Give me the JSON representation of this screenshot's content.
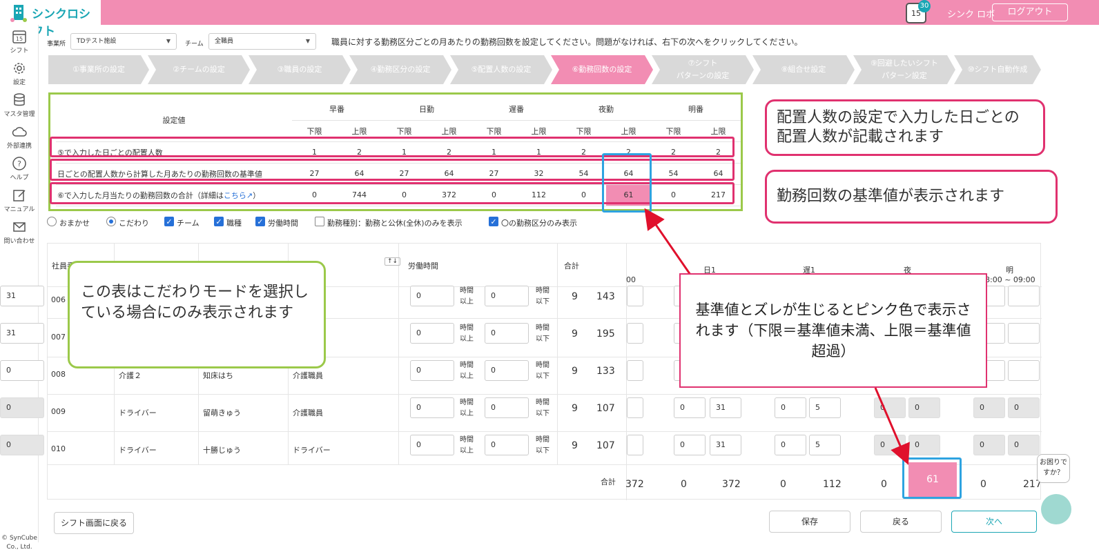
{
  "app": {
    "name": "シンクロシフト",
    "calendar_badge": "30",
    "calendar_day": "15",
    "user": "シンク ロボ",
    "logout": "ログアウト"
  },
  "sidebar": [
    {
      "label": "シフト",
      "icon": "calendar-icon"
    },
    {
      "label": "設定",
      "icon": "gear-icon"
    },
    {
      "label": "マスタ管理",
      "icon": "database-icon"
    },
    {
      "label": "外部連携",
      "icon": "cloud-icon"
    },
    {
      "label": "ヘルプ",
      "icon": "help-icon"
    },
    {
      "label": "マニュアル",
      "icon": "manual-icon"
    },
    {
      "label": "問い合わせ",
      "icon": "mail-icon"
    }
  ],
  "copyright": "© SynCube Co., Ltd.",
  "filters": {
    "office_label": "事業所",
    "office_value": "TDテスト施設",
    "team_label": "チーム",
    "team_value": "全職員"
  },
  "instruction": "職員に対する勤務区分ごとの月あたりの勤務回数を設定してください。問題がなければ、右下の次へをクリックしてください。",
  "steps": [
    {
      "label": "①事業所の設定"
    },
    {
      "label": "②チームの設定"
    },
    {
      "label": "③職員の設定"
    },
    {
      "label": "④勤務区分の設定"
    },
    {
      "label": "⑤配置人数の設定"
    },
    {
      "label": "⑥勤務回数の設定",
      "active": true
    },
    {
      "label": "⑦シフト",
      "label2": "パターンの設定"
    },
    {
      "label": "⑧組合せ設定"
    },
    {
      "label": "⑨回避したいシフト",
      "label2": "パターン設定"
    },
    {
      "label": "⑩シフト自動作成"
    }
  ],
  "summary": {
    "header_label": "設定値",
    "groups": [
      "早番",
      "日勤",
      "遅番",
      "夜勤",
      "明番"
    ],
    "sub": [
      "下限",
      "上限"
    ],
    "rows": [
      {
        "label": "⑤で入力した日ごとの配置人数",
        "values": [
          "1",
          "2",
          "1",
          "2",
          "1",
          "1",
          "2",
          "2",
          "2",
          "2"
        ]
      },
      {
        "label": "日ごとの配置人数から計算した月あたりの勤務回数の基準値",
        "values": [
          "27",
          "64",
          "27",
          "64",
          "27",
          "32",
          "54",
          "64",
          "54",
          "64"
        ]
      },
      {
        "label": "⑥で入力した月当たりの勤務回数の合計（詳細は",
        "link": "こちら",
        "tail": "）",
        "values": [
          "0",
          "744",
          "0",
          "372",
          "0",
          "112",
          "0",
          "61",
          "0",
          "217"
        ]
      }
    ]
  },
  "options": {
    "radio1": "おまかせ",
    "radio2": "こだわり",
    "chk": [
      "チーム",
      "職種",
      "労働時間",
      "勤務種別：勤務と公休(全休)のみを表示",
      "〇の勤務区分のみ表示"
    ]
  },
  "table": {
    "col_id": "社員番号",
    "col_work": "労働時間",
    "col_total": "合計",
    "shift_heads": [
      {
        "label": "",
        "sub": "00"
      },
      {
        "label": "日1",
        "sub": ""
      },
      {
        "label": "遅1",
        "sub": ""
      },
      {
        "label": "夜",
        "sub": ""
      },
      {
        "label": "明",
        "sub": "8:00 ~ 09:00"
      }
    ],
    "unit_min": [
      "時間",
      "以上"
    ],
    "unit_max": [
      "時間",
      "以下"
    ],
    "rows": [
      {
        "id": "006",
        "job": "",
        "name": "",
        "role": "",
        "min": "0",
        "max": "0",
        "n": "9",
        "total": "143",
        "cells": [
          "",
          "",
          "",
          "",
          "",
          "",
          "",
          "",
          "",
          "31"
        ]
      },
      {
        "id": "007",
        "job": "",
        "name": "",
        "role": "",
        "min": "0",
        "max": "0",
        "n": "9",
        "total": "195",
        "cells": [
          "",
          "",
          "",
          "",
          "",
          "",
          "",
          "",
          "",
          "31"
        ]
      },
      {
        "id": "008",
        "job": "介護２",
        "name": "知床はち",
        "role": "介護職員",
        "min": "0",
        "max": "0",
        "n": "9",
        "total": "133",
        "cells": [
          "",
          "",
          "",
          "",
          "",
          "",
          "",
          "",
          "",
          "0"
        ]
      },
      {
        "id": "009",
        "job": "ドライバー",
        "name": "留萌きゅう",
        "role": "介護職員",
        "min": "0",
        "max": "0",
        "n": "9",
        "total": "107",
        "cells": [
          "",
          "0",
          "31",
          "0",
          "5",
          "0",
          "0",
          "0",
          "0",
          "0"
        ]
      },
      {
        "id": "010",
        "job": "ドライバー",
        "name": "十勝じゅう",
        "role": "ドライバー",
        "min": "0",
        "max": "0",
        "n": "9",
        "total": "107",
        "cells": [
          "",
          "0",
          "31",
          "0",
          "5",
          "0",
          "0",
          "0",
          "0",
          "0"
        ]
      }
    ],
    "sum_label": "合計",
    "sums": [
      "372",
      "0",
      "372",
      "0",
      "112",
      "0",
      "61",
      "0",
      "217"
    ]
  },
  "callouts": {
    "c1": "配置人数の設定で入力した日ごとの配置人数が記載されます",
    "c2": "勤務回数の基準値が表示されます",
    "c3": "この表はこだわりモードを選択している場合にのみ表示されます",
    "c4": "基準値とズレが生じるとピンク色で表示されます（下限＝基準値未満、上限＝基準値超過）"
  },
  "buttons": {
    "back_to_shift": "シフト画面に戻る",
    "save": "保存",
    "back": "戻る",
    "next": "次へ"
  },
  "help": "お困りですか？"
}
